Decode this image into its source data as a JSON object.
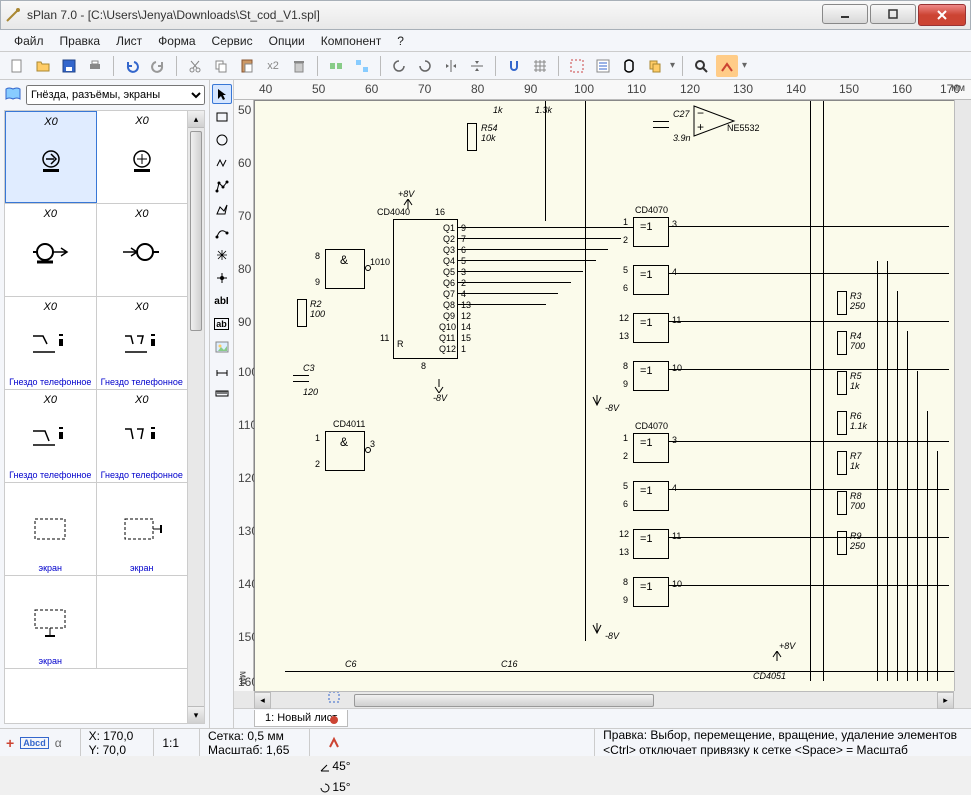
{
  "window": {
    "title": "sPlan 7.0 - [C:\\Users\\Jenya\\Downloads\\St_cod_V1.spl]"
  },
  "menu": {
    "items": [
      "Файл",
      "Правка",
      "Лист",
      "Форма",
      "Сервис",
      "Опции",
      "Компонент",
      "?"
    ]
  },
  "toolbar": {
    "clone_label": "x2"
  },
  "category": {
    "value": "Гнёзда, разъёмы, экраны"
  },
  "components": [
    {
      "label": "X0",
      "caption": "",
      "selected": true,
      "type": "socket-circle"
    },
    {
      "label": "X0",
      "caption": "",
      "type": "socket-circle-2"
    },
    {
      "label": "X0",
      "caption": "",
      "type": "socket-arrow"
    },
    {
      "label": "X0",
      "caption": "",
      "type": "socket-arrow-2"
    },
    {
      "label": "X0",
      "caption": "Гнездо телефонное",
      "type": "jack-1"
    },
    {
      "label": "X0",
      "caption": "Гнездо телефонное",
      "type": "jack-2"
    },
    {
      "label": "X0",
      "caption": "Гнездо телефонное",
      "type": "jack-3"
    },
    {
      "label": "X0",
      "caption": "Гнездо телефонное",
      "type": "jack-4"
    },
    {
      "label": "",
      "caption": "экран",
      "type": "shield"
    },
    {
      "label": "",
      "caption": "экран",
      "type": "shield-t"
    },
    {
      "label": "",
      "caption": "экран",
      "type": "shield-b"
    },
    {
      "label": "",
      "caption": "",
      "type": "empty"
    }
  ],
  "ruler": {
    "h_ticks": [
      "40",
      "50",
      "60",
      "70",
      "80",
      "90",
      "100",
      "110",
      "120",
      "130",
      "140",
      "150",
      "160",
      "170"
    ],
    "h_unit": "мм",
    "v_ticks": [
      "50",
      "60",
      "70",
      "80",
      "90",
      "100",
      "110",
      "120",
      "130",
      "140",
      "150",
      "160"
    ],
    "v_unit": "мм"
  },
  "tabs": {
    "active": "1: Новый лист"
  },
  "status": {
    "coord_x": "X: 170,0",
    "coord_y": "Y: 70,0",
    "ratio": "1:1",
    "grid_label": "Сетка:",
    "grid_value": "0,5 мм",
    "scale_label": "Масштаб:",
    "scale_value": "1,65",
    "angle1": "45°",
    "angle2": "15°",
    "help_line1": "Правка: Выбор, перемещение, вращение, удаление элементов",
    "help_line2": "<Ctrl> отключает привязку к сетке  <Space> = Масштаб"
  },
  "schematic": {
    "parts": {
      "r54": "R54",
      "r54_val": "10k",
      "c27": "C27",
      "c27_val": "3.9n",
      "ne5532": "NE5532",
      "cd4040": "CD4040",
      "cd4011": "CD4011",
      "cd4070_1": "CD4070",
      "cd4070_2": "CD4070",
      "cd4051": "CD4051",
      "r2": "R2",
      "r2_val": "100",
      "c3": "C3",
      "c3_val": "120",
      "r3": "R3",
      "r3_val": "250",
      "r4": "R4",
      "r4_val": "700",
      "r5": "R5",
      "r5_val": "1k",
      "r6": "R6",
      "r6_val": "1.1k",
      "r7": "R7",
      "r7_val": "1k",
      "r8": "R8",
      "r8_val": "700",
      "r9": "R9",
      "r9_val": "250",
      "c6": "C6",
      "c16": "C16",
      "v_p8": "+8V",
      "v_n8": "-8V",
      "one_k": "1k",
      "one_three_k": "1.3k"
    },
    "ic_pins": {
      "cd4040_top": "16",
      "cd4040_bot": "8",
      "cd4040_left": [
        "10",
        "11"
      ],
      "cd4040_right_labels": [
        "Q1",
        "Q2",
        "Q3",
        "Q4",
        "Q5",
        "Q6",
        "Q7",
        "Q8",
        "Q9",
        "Q10",
        "Q11",
        "Q12"
      ],
      "cd4040_right_pins": [
        "9",
        "7",
        "6",
        "5",
        "3",
        "2",
        "4",
        "13",
        "12",
        "14",
        "15",
        "1"
      ],
      "gate_amp": "&",
      "gate_eq": "=1",
      "nand_pins_t": [
        "8",
        "9",
        "10"
      ],
      "nand_pins_b": [
        "1",
        "2",
        "3"
      ],
      "xor_groups": [
        [
          "1",
          "2",
          "3"
        ],
        [
          "5",
          "6",
          "4"
        ],
        [
          "12",
          "13",
          "11"
        ],
        [
          "8",
          "9",
          "10"
        ],
        [
          "1",
          "2",
          "3"
        ],
        [
          "5",
          "6",
          "4"
        ],
        [
          "12",
          "13",
          "11"
        ],
        [
          "8",
          "9",
          "10"
        ]
      ]
    }
  }
}
